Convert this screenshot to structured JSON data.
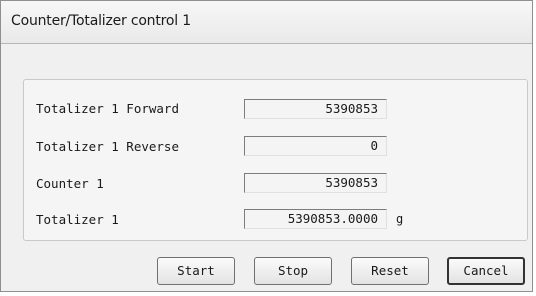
{
  "window": {
    "title": "Counter/Totalizer control 1"
  },
  "rows": [
    {
      "label": "Totalizer 1 Forward",
      "value": "5390853",
      "unit": ""
    },
    {
      "label": "Totalizer 1 Reverse",
      "value": "0",
      "unit": ""
    },
    {
      "label": "Counter 1",
      "value": "5390853",
      "unit": ""
    },
    {
      "label": "Totalizer 1",
      "value": "5390853.0000",
      "unit": "g"
    }
  ],
  "buttons": {
    "start": "Start",
    "stop": "Stop",
    "reset": "Reset",
    "cancel": "Cancel"
  }
}
